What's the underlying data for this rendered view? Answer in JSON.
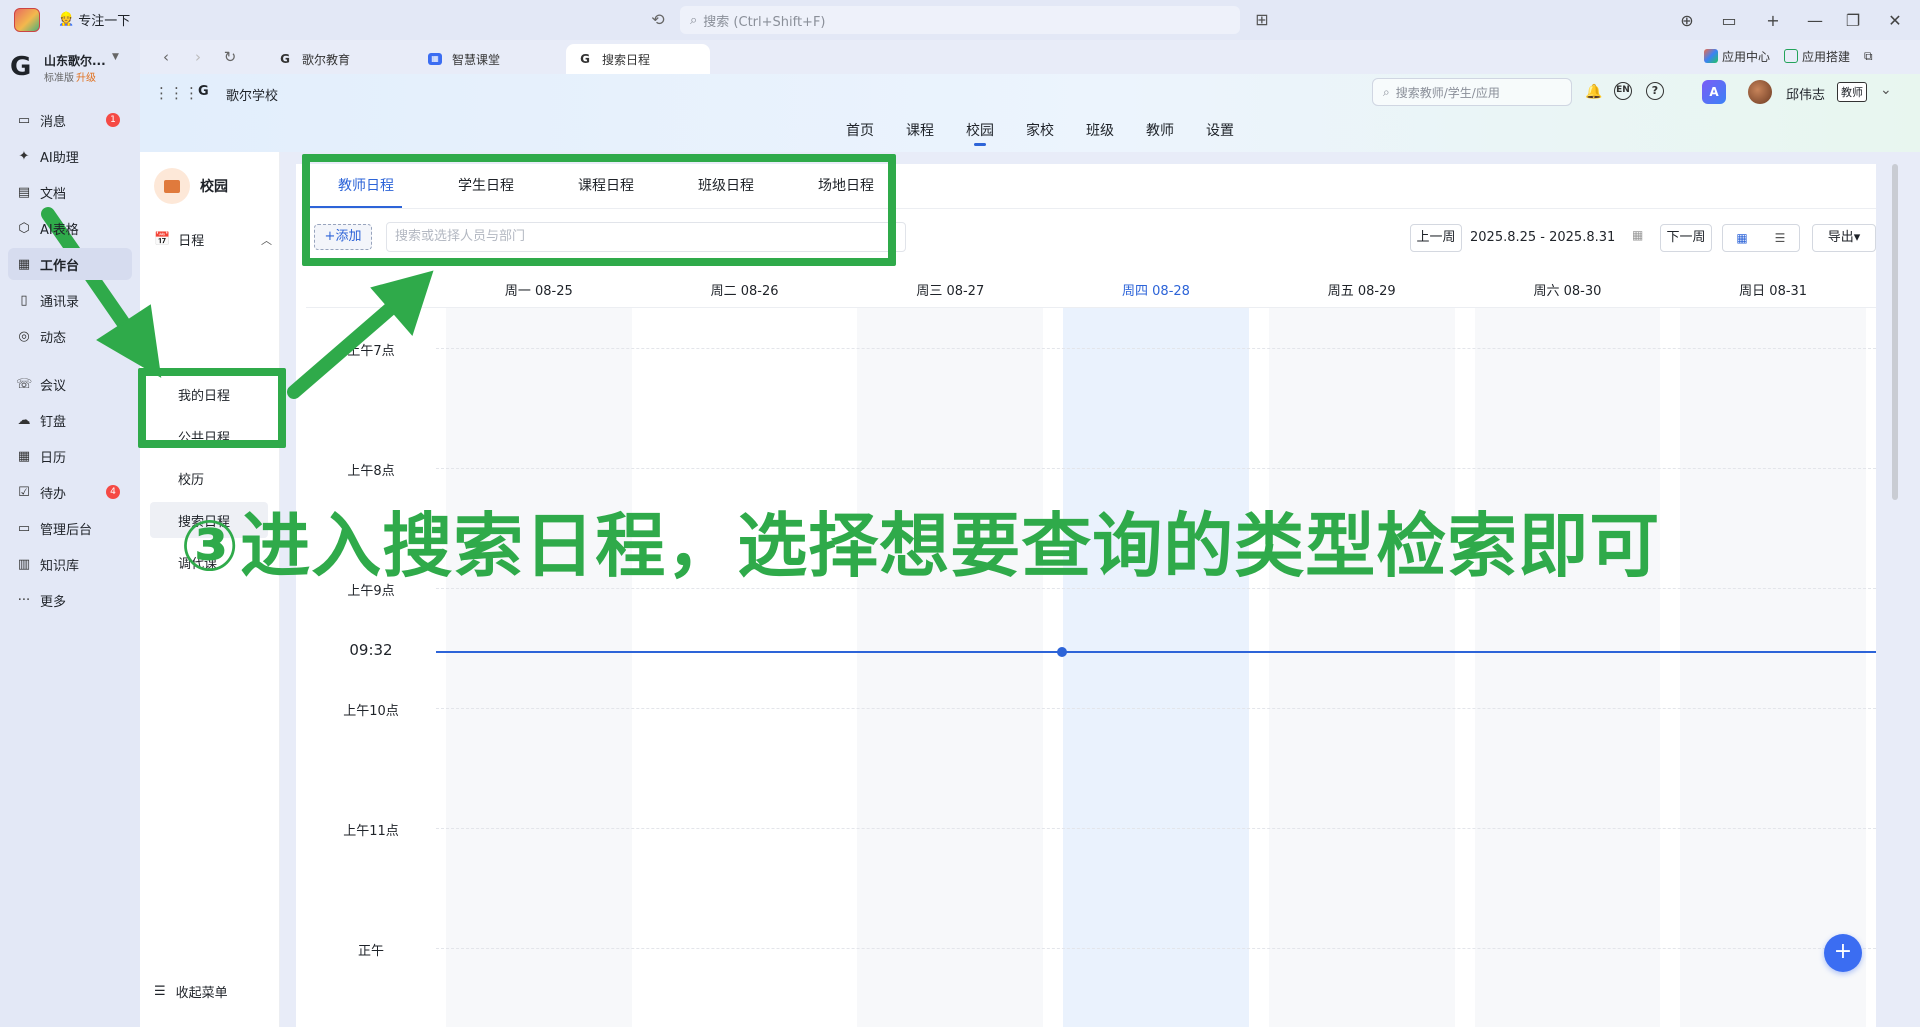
{
  "titlebar": {
    "focus": "专注一下",
    "search_placeholder": "搜索 (Ctrl+Shift+F)",
    "controls": [
      "⊕",
      "▭",
      "+",
      "—",
      "❐",
      "✕"
    ]
  },
  "org": {
    "name": "山东歌尔...",
    "plan": "标准版",
    "upgrade": "升级"
  },
  "leftnav": {
    "items": [
      {
        "label": "消息",
        "icon": "chat-icon",
        "badge": "1"
      },
      {
        "label": "AI助理",
        "icon": "ai-icon"
      },
      {
        "label": "文档",
        "icon": "doc-icon"
      },
      {
        "label": "AI表格",
        "icon": "table-icon"
      },
      {
        "label": "工作台",
        "icon": "workbench-icon",
        "active": true
      },
      {
        "label": "通讯录",
        "icon": "contacts-icon"
      },
      {
        "label": "动态",
        "icon": "feed-icon"
      },
      {
        "label": "会议",
        "icon": "meeting-icon"
      },
      {
        "label": "钉盘",
        "icon": "cloud-icon"
      },
      {
        "label": "日历",
        "icon": "calendar-icon"
      },
      {
        "label": "待办",
        "icon": "todo-icon",
        "badge": "4"
      },
      {
        "label": "管理后台",
        "icon": "admin-icon"
      },
      {
        "label": "知识库",
        "icon": "book-icon"
      },
      {
        "label": "更多",
        "icon": "more-icon"
      }
    ]
  },
  "browser_tabs": [
    {
      "label": "歌尔教育",
      "icon": "G"
    },
    {
      "label": "智慧课堂",
      "icon": "▦"
    },
    {
      "label": "搜索日程",
      "icon": "G",
      "active": true
    }
  ],
  "tab_right": {
    "app_center": "应用中心",
    "app_build": "应用搭建"
  },
  "app": {
    "school": "歌尔学校",
    "logo": "G",
    "menu": [
      "首页",
      "课程",
      "校园",
      "家校",
      "班级",
      "教师",
      "设置"
    ],
    "active_menu": 2,
    "search_placeholder": "搜索教师/学生/应用",
    "user_name": "邱伟志",
    "role": "教师"
  },
  "subpanel": {
    "title": "校园",
    "group": "日程",
    "items": [
      "我的日程",
      "公共日程",
      "校历",
      "搜索日程",
      "调代课"
    ],
    "active": 3,
    "collapse": "收起菜单"
  },
  "schedule": {
    "tabs": [
      "教师日程",
      "学生日程",
      "课程日程",
      "班级日程",
      "场地日程"
    ],
    "active_tab": 0,
    "add_label": "+添加",
    "search_placeholder": "搜索或选择人员与部门",
    "prev_week": "上一周",
    "date_range": "2025.8.25 - 2025.8.31",
    "next_week": "下一周",
    "export": "导出▾",
    "days": [
      "周一 08-25",
      "周二 08-26",
      "周三 08-27",
      "周四 08-28",
      "周五 08-29",
      "周六 08-30",
      "周日 08-31"
    ],
    "today_index": 3,
    "hours": [
      "上午7点",
      "上午8点",
      "上午9点",
      "上午10点",
      "上午11点",
      "正午"
    ],
    "now": "09:32"
  },
  "annotation": {
    "text": "③进入搜索日程，选择想要查询的类型检索即可",
    "color": "#2faa4a"
  },
  "colors": {
    "accent": "#2d64d8",
    "annotation_green": "#2faa4a",
    "badge_red": "#f54a45"
  }
}
